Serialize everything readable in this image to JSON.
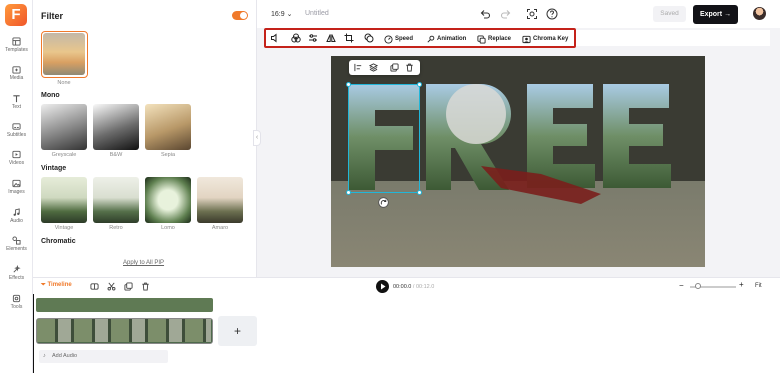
{
  "app": {
    "logo_letter": "F"
  },
  "sidebar": {
    "items": [
      {
        "label": "Templates",
        "icon": "templates-icon"
      },
      {
        "label": "Media",
        "icon": "media-icon"
      },
      {
        "label": "Text",
        "icon": "text-icon"
      },
      {
        "label": "Subtitles",
        "icon": "subtitles-icon"
      },
      {
        "label": "Videos",
        "icon": "videos-icon"
      },
      {
        "label": "Images",
        "icon": "images-icon"
      },
      {
        "label": "Audio",
        "icon": "audio-icon"
      },
      {
        "label": "Elements",
        "icon": "elements-icon"
      },
      {
        "label": "Effects",
        "icon": "effects-icon"
      },
      {
        "label": "Tools",
        "icon": "tools-icon"
      }
    ]
  },
  "filter_panel": {
    "title": "Filter",
    "toggle_on": true,
    "none_label": "None",
    "sections": [
      {
        "title": "Mono",
        "items": [
          "Greyscale",
          "B&W",
          "Sepia"
        ]
      },
      {
        "title": "Vintage",
        "items": [
          "Vintage",
          "Retro",
          "Lomo",
          "Amaro"
        ]
      },
      {
        "title": "Chromatic"
      }
    ],
    "apply_label": "Apply to All PIP"
  },
  "topbar": {
    "aspect_ratio": "16:9",
    "project_name": "Untitled",
    "saved_label": "Saved",
    "export_label": "Export",
    "export_arrow": "→"
  },
  "toolbar": {
    "speed": "Speed",
    "animation": "Animation",
    "replace": "Replace",
    "chroma_key": "Chroma Key"
  },
  "canvas": {
    "overlay_text": "FREE"
  },
  "timeline": {
    "label": "Timeline",
    "current_time": "00:00.0",
    "separator": "/",
    "total_time": "00:12.0",
    "fit_label": "Fit",
    "add_audio": "Add Audio",
    "zoom_minus": "−",
    "zoom_plus": "+",
    "add_clip": "+"
  },
  "colors": {
    "accent": "#f07a2b",
    "highlight_border": "#c4221a",
    "selection": "#21b6d9"
  }
}
